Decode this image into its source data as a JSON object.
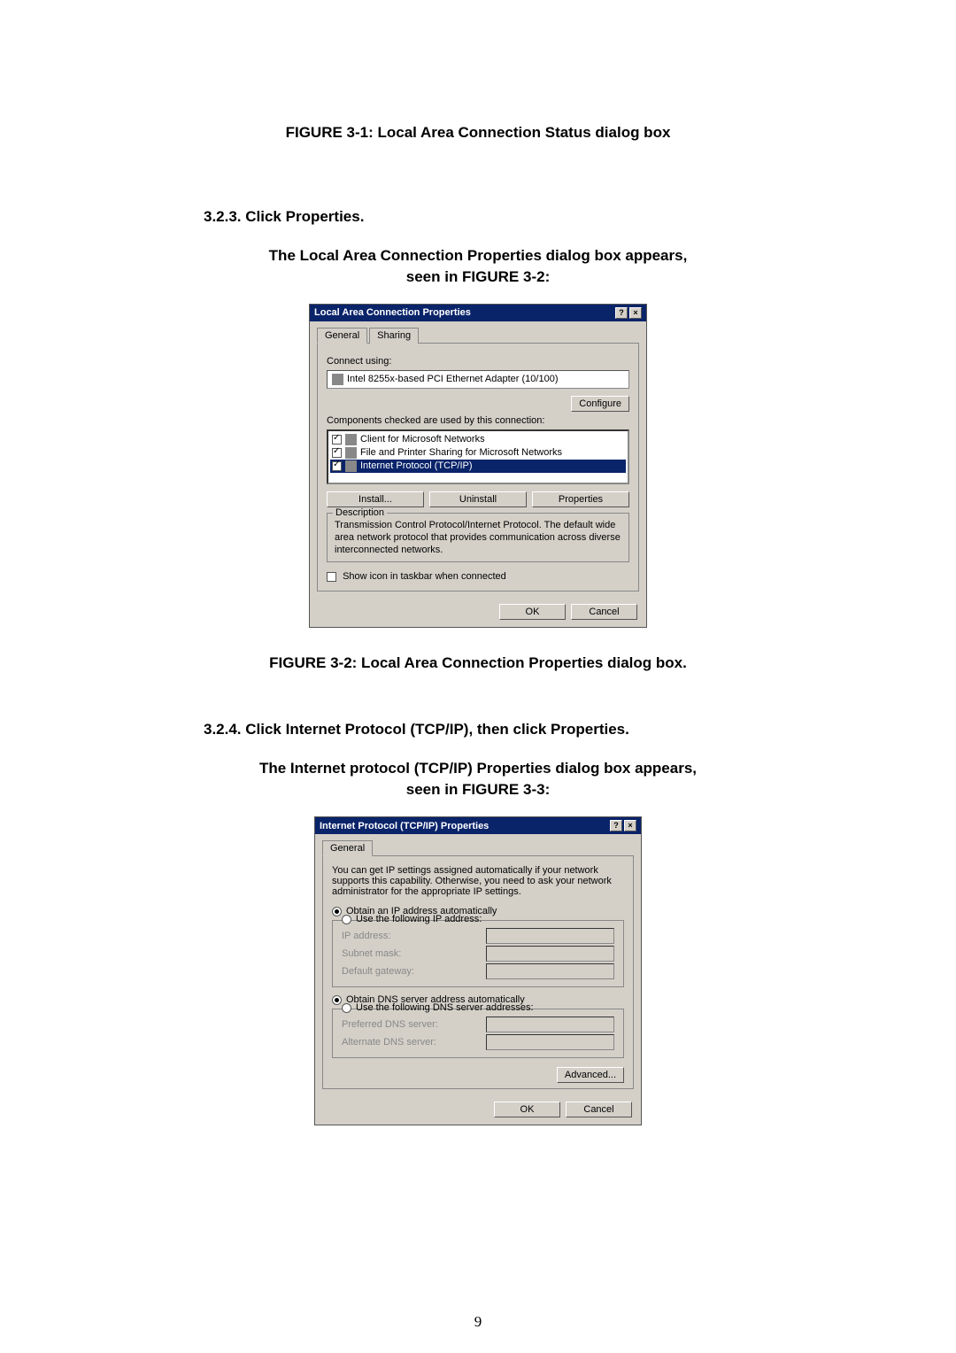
{
  "figure31_caption": "FIGURE 3-1: Local Area Connection Status dialog box",
  "section_323": "3.2.3. Click Properties.",
  "section_323_sub": "The Local Area Connection Properties dialog box appears,\nseen in FIGURE 3-2:",
  "dialog1": {
    "title": "Local Area Connection Properties",
    "tabs": {
      "general": "General",
      "sharing": "Sharing"
    },
    "connect_using_label": "Connect using:",
    "adapter": "Intel 8255x-based PCI Ethernet Adapter (10/100)",
    "configure_btn": "Configure",
    "components_label": "Components checked are used by this connection:",
    "items": [
      "Client for Microsoft Networks",
      "File and Printer Sharing for Microsoft Networks",
      "Internet Protocol (TCP/IP)"
    ],
    "install_btn": "Install...",
    "uninstall_btn": "Uninstall",
    "properties_btn": "Properties",
    "description_label": "Description",
    "description_text": "Transmission Control Protocol/Internet Protocol. The default wide area network protocol that provides communication across diverse interconnected networks.",
    "show_icon": "Show icon in taskbar when connected",
    "ok": "OK",
    "cancel": "Cancel"
  },
  "figure32_caption": "FIGURE 3-2: Local Area Connection Properties dialog box.",
  "section_324": "3.2.4. Click Internet Protocol (TCP/IP), then click Properties.",
  "section_324_sub": "The Internet protocol (TCP/IP) Properties dialog box appears,\nseen in FIGURE 3-3:",
  "dialog2": {
    "title": "Internet Protocol (TCP/IP) Properties",
    "tab_general": "General",
    "intro": "You can get IP settings assigned automatically if your network supports this capability. Otherwise, you need to ask your network administrator for the appropriate IP settings.",
    "obtain_ip": "Obtain an IP address automatically",
    "use_ip": "Use the following IP address:",
    "ip_address": "IP address:",
    "subnet": "Subnet mask:",
    "gateway": "Default gateway:",
    "obtain_dns": "Obtain DNS server address automatically",
    "use_dns": "Use the following DNS server addresses:",
    "preferred_dns": "Preferred DNS server:",
    "alternate_dns": "Alternate DNS server:",
    "advanced_btn": "Advanced...",
    "ok": "OK",
    "cancel": "Cancel"
  },
  "page_number": "9"
}
